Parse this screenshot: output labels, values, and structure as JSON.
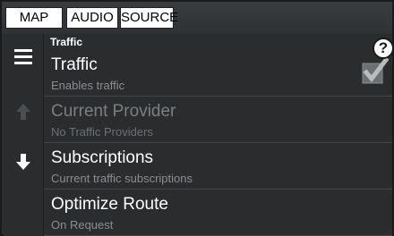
{
  "tabs": [
    {
      "label": "MAP"
    },
    {
      "label": "AUDIO"
    },
    {
      "label": "SOURCE"
    }
  ],
  "section": {
    "title": "Traffic"
  },
  "help": {
    "label": "?"
  },
  "sidebar": {
    "menu_icon": "hamburger-menu-icon",
    "up_icon": "arrow-up-icon",
    "down_icon": "arrow-down-icon"
  },
  "rows": [
    {
      "title": "Traffic",
      "subtitle": "Enables traffic",
      "checked": true
    },
    {
      "title": "Current Provider",
      "subtitle": "No Traffic Providers",
      "disabled": true
    },
    {
      "title": "Subscriptions",
      "subtitle": "Current traffic subscriptions"
    },
    {
      "title": "Optimize Route",
      "subtitle": "On Request"
    }
  ]
}
